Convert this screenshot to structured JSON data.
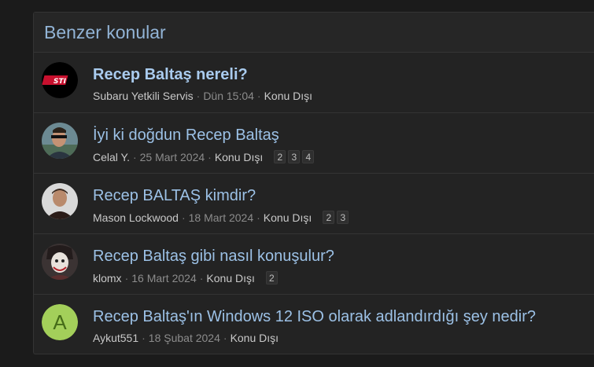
{
  "header": {
    "title": "Benzer konular"
  },
  "threads": [
    {
      "title": "Recep Baltaş nereli?",
      "author": "Subaru Yetkili Servis",
      "date": "Dün 15:04",
      "forum": "Konu Dışı",
      "pages": [],
      "avatar": "sti-logo"
    },
    {
      "title": "İyi ki doğdun Recep Baltaş",
      "author": "Celal Y.",
      "date": "25 Mart 2024",
      "forum": "Konu Dışı",
      "pages": [
        "2",
        "3",
        "4"
      ],
      "avatar": "photo"
    },
    {
      "title": "Recep BALTAŞ kimdir?",
      "author": "Mason Lockwood",
      "date": "18 Mart 2024",
      "forum": "Konu Dışı",
      "pages": [
        "2",
        "3"
      ],
      "avatar": "photo"
    },
    {
      "title": "Recep Baltaş gibi nasıl konuşulur?",
      "author": "klomx",
      "date": "16 Mart 2024",
      "forum": "Konu Dışı",
      "pages": [
        "2"
      ],
      "avatar": "photo"
    },
    {
      "title": "Recep Baltaş'ın Windows 12 ISO olarak adlandırdığı şey nedir?",
      "author": "Aykut551",
      "date": "18 Şubat 2024",
      "forum": "Konu Dışı",
      "pages": [],
      "avatar_letter": "A"
    }
  ],
  "separator": "·",
  "colors": {
    "link": "#9cc1e6",
    "letter_avatar_bg": "#a3cf5a"
  }
}
